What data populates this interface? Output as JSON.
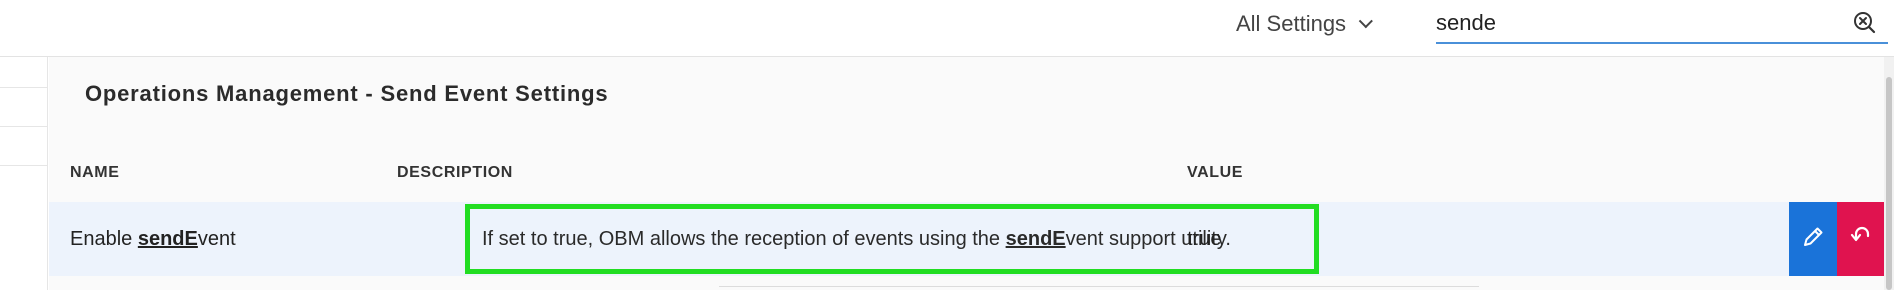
{
  "topbar": {
    "scope_label": "All Settings",
    "search_value": "sende"
  },
  "panel": {
    "title": "Operations Management - Send Event Settings",
    "columns": {
      "name": "NAME",
      "description": "DESCRIPTION",
      "value": "VALUE"
    },
    "row": {
      "name_prefix": "Enable ",
      "name_match": "sendE",
      "name_suffix": "vent",
      "desc_prefix": "If set to true, OBM allows the reception of events using the ",
      "desc_match": "sendE",
      "desc_suffix": "vent support utility.",
      "value": "true"
    }
  },
  "colors": {
    "edit_button": "#1a73d9",
    "revert_button": "#e0134f",
    "focus_outline": "#22dd22",
    "row_highlight": "#edf3fc",
    "search_underline": "#4a90d9"
  },
  "icons": {
    "scope_dropdown": "chevron-down-icon",
    "search_clear": "clear-search-icon",
    "edit": "pencil-icon",
    "revert": "undo-icon"
  }
}
